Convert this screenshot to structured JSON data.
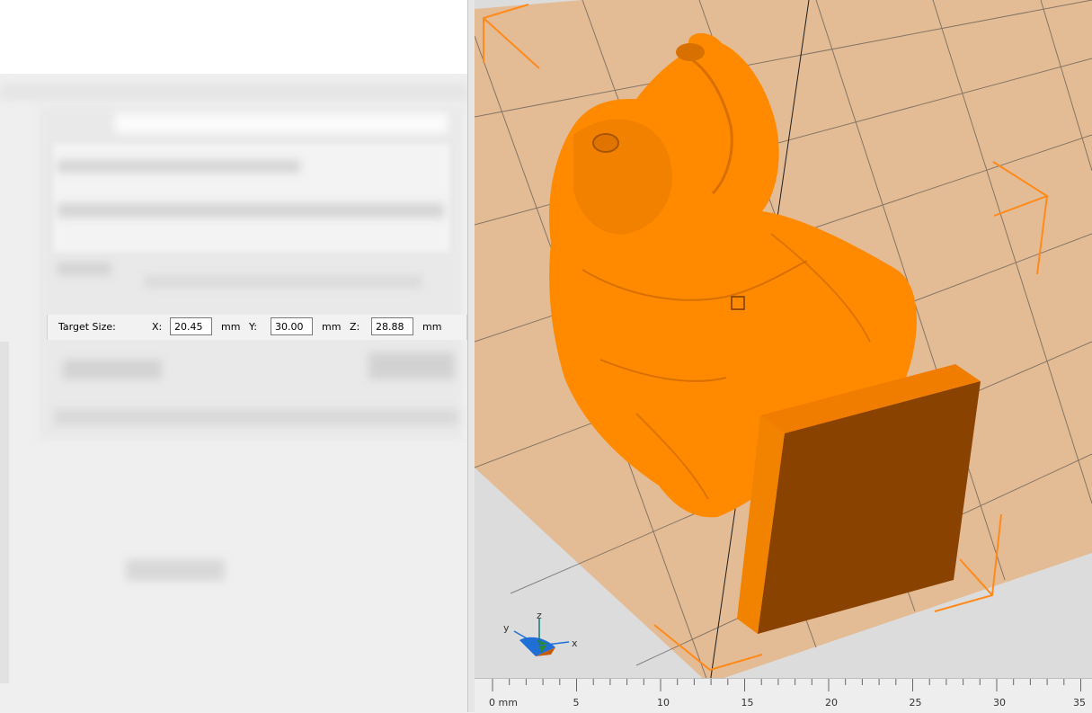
{
  "target_size": {
    "label": "Target Size:",
    "x": {
      "axis": "X:",
      "value": "20.45",
      "unit": "mm"
    },
    "y": {
      "axis": "Y:",
      "value": "30.00",
      "unit": "mm"
    },
    "z": {
      "axis": "Z:",
      "value": "28.88",
      "unit": "mm"
    }
  },
  "axis_gizmo": {
    "x": "x",
    "y": "y",
    "z": "z"
  },
  "ruler": {
    "labels": [
      "0 mm",
      "5",
      "10",
      "15",
      "20",
      "25",
      "30",
      "35"
    ]
  },
  "colors": {
    "bed": "#e3bc96",
    "model": "#ff8a00",
    "model_base": "#8a4200",
    "bounding_box": "#ff8a1a"
  },
  "icons": [
    "axis-gizmo-icon",
    "selection-handle-icon"
  ]
}
